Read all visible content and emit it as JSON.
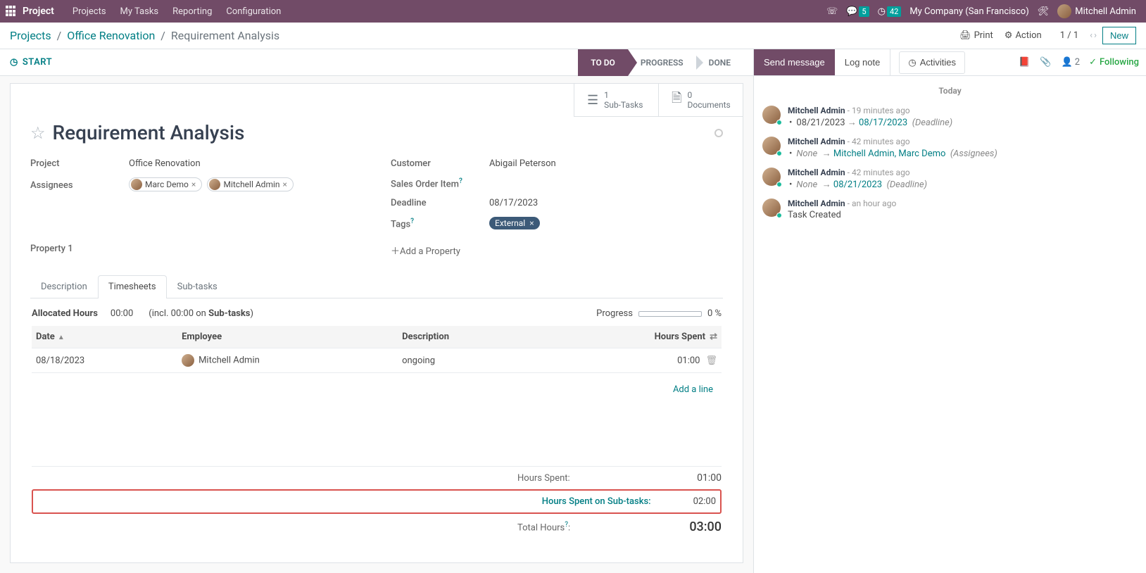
{
  "topbar": {
    "brand": "Project",
    "nav": [
      "Projects",
      "My Tasks",
      "Reporting",
      "Configuration"
    ],
    "chat_count": "5",
    "clock_count": "42",
    "company": "My Company (San Francisco)",
    "user": "Mitchell Admin"
  },
  "control": {
    "crumb1": "Projects",
    "crumb2": "Office Renovation",
    "crumb3": "Requirement Analysis",
    "print": "Print",
    "action": "Action",
    "pager": "1 / 1",
    "new": "New"
  },
  "status": {
    "start": "START",
    "stages": [
      "TO DO",
      "PROGRESS",
      "DONE"
    ],
    "active": 0
  },
  "stats": {
    "subtasks_count": "1",
    "subtasks_label": "Sub-Tasks",
    "docs_count": "0",
    "docs_label": "Documents"
  },
  "record": {
    "title": "Requirement Analysis",
    "labels": {
      "project": "Project",
      "assignees": "Assignees",
      "customer": "Customer",
      "soi": "Sales Order Item",
      "deadline": "Deadline",
      "tags": "Tags",
      "property1": "Property 1",
      "addprop": "Add a Property"
    },
    "project": "Office Renovation",
    "assignees": [
      "Marc Demo",
      "Mitchell Admin"
    ],
    "customer": "Abigail Peterson",
    "deadline": "08/17/2023",
    "tag": "External"
  },
  "tabs": {
    "items": [
      "Description",
      "Timesheets",
      "Sub-tasks"
    ],
    "active": 1
  },
  "alloc": {
    "label": "Allocated Hours",
    "hours": "00:00",
    "incl_prefix": "(incl. 00:00 on ",
    "incl_bold": "Sub-tasks",
    "incl_suffix": ")",
    "progress_label": "Progress",
    "progress_pct": "0 %"
  },
  "timesheet": {
    "cols": {
      "date": "Date",
      "employee": "Employee",
      "desc": "Description",
      "hours": "Hours Spent"
    },
    "rows": [
      {
        "date": "08/18/2023",
        "employee": "Mitchell Admin",
        "desc": "ongoing",
        "hours": "01:00"
      }
    ],
    "addline": "Add a line"
  },
  "totals": {
    "hours_spent_label": "Hours Spent:",
    "hours_spent_value": "01:00",
    "sub_label": "Hours Spent on Sub-tasks:",
    "sub_value": "02:00",
    "total_label": "Total Hours",
    "total_suffix": ":",
    "total_value": "03:00"
  },
  "chatter": {
    "send": "Send message",
    "lognote": "Log note",
    "activities": "Activities",
    "follow_count": "2",
    "following": "Following",
    "today": "Today",
    "entries": [
      {
        "author": "Mitchell Admin",
        "time": "19 minutes ago",
        "old": "08/21/2023",
        "new": "08/17/2023",
        "suffix": "(Deadline)"
      },
      {
        "author": "Mitchell Admin",
        "time": "42 minutes ago",
        "old_it": "None",
        "new": "Mitchell Admin, Marc Demo",
        "suffix": "(Assignees)"
      },
      {
        "author": "Mitchell Admin",
        "time": "42 minutes ago",
        "old_it": "None",
        "new": "08/21/2023",
        "suffix": "(Deadline)"
      },
      {
        "author": "Mitchell Admin",
        "time": "an hour ago",
        "text": "Task Created"
      }
    ]
  }
}
